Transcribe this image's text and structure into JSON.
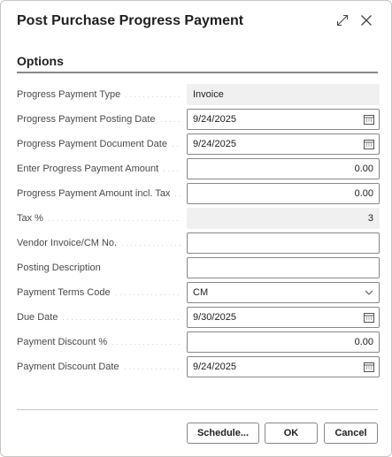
{
  "dialog": {
    "title": "Post Purchase Progress Payment",
    "expand_icon": "expand-arrows-icon",
    "close_icon": "close-icon"
  },
  "section": {
    "title": "Options"
  },
  "fields": {
    "payment_type": {
      "label": "Progress Payment Type",
      "value": "Invoice"
    },
    "posting_date": {
      "label": "Progress Payment Posting Date",
      "value": "9/24/2025",
      "icon": "calendar-icon"
    },
    "document_date": {
      "label": "Progress Payment Document Date",
      "value": "9/24/2025",
      "icon": "calendar-icon"
    },
    "amount": {
      "label": "Enter Progress Payment Amount",
      "value": "0.00"
    },
    "amount_incl_tax": {
      "label": "Progress Payment Amount incl. Tax",
      "value": "0.00"
    },
    "tax_pct": {
      "label": "Tax %",
      "value": "3"
    },
    "vendor_invoice": {
      "label": "Vendor Invoice/CM No.",
      "value": ""
    },
    "posting_description": {
      "label": "Posting Description",
      "value": ""
    },
    "payment_terms": {
      "label": "Payment Terms Code",
      "value": "CM",
      "icon": "chevron-down-icon"
    },
    "due_date": {
      "label": "Due Date",
      "value": "9/30/2025",
      "icon": "calendar-icon"
    },
    "discount_pct": {
      "label": "Payment Discount %",
      "value": "0.00"
    },
    "discount_date": {
      "label": "Payment Discount Date",
      "value": "9/24/2025",
      "icon": "calendar-icon"
    }
  },
  "buttons": {
    "schedule": "Schedule...",
    "ok": "OK",
    "cancel": "Cancel"
  },
  "colors": {
    "border": "#8a8886",
    "readonly_bg": "#f0f0f0",
    "text": "#212121"
  }
}
